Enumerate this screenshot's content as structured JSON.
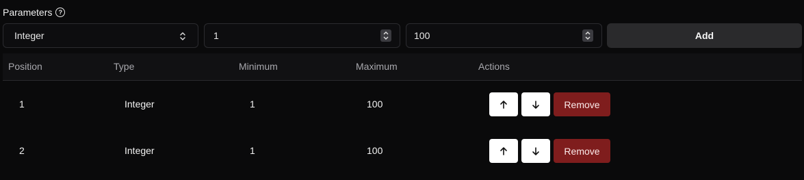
{
  "header": {
    "title": "Parameters",
    "help_icon": "question-circle-icon"
  },
  "controls": {
    "type_select": {
      "value": "Integer",
      "icon": "chevron-updown-icon"
    },
    "min_input": {
      "value": "1"
    },
    "max_input": {
      "value": "100"
    },
    "add_label": "Add"
  },
  "table": {
    "columns": [
      "Position",
      "Type",
      "Minimum",
      "Maximum",
      "Actions"
    ],
    "rows": [
      {
        "position": "1",
        "type": "Integer",
        "minimum": "1",
        "maximum": "100"
      },
      {
        "position": "2",
        "type": "Integer",
        "minimum": "1",
        "maximum": "100"
      }
    ],
    "remove_label": "Remove",
    "icons": {
      "up": "arrow-up-icon",
      "down": "arrow-down-icon"
    }
  },
  "colors": {
    "background": "#0a0a0b",
    "remove_button": "#7f1d1d",
    "add_button": "#2a2a2c"
  }
}
